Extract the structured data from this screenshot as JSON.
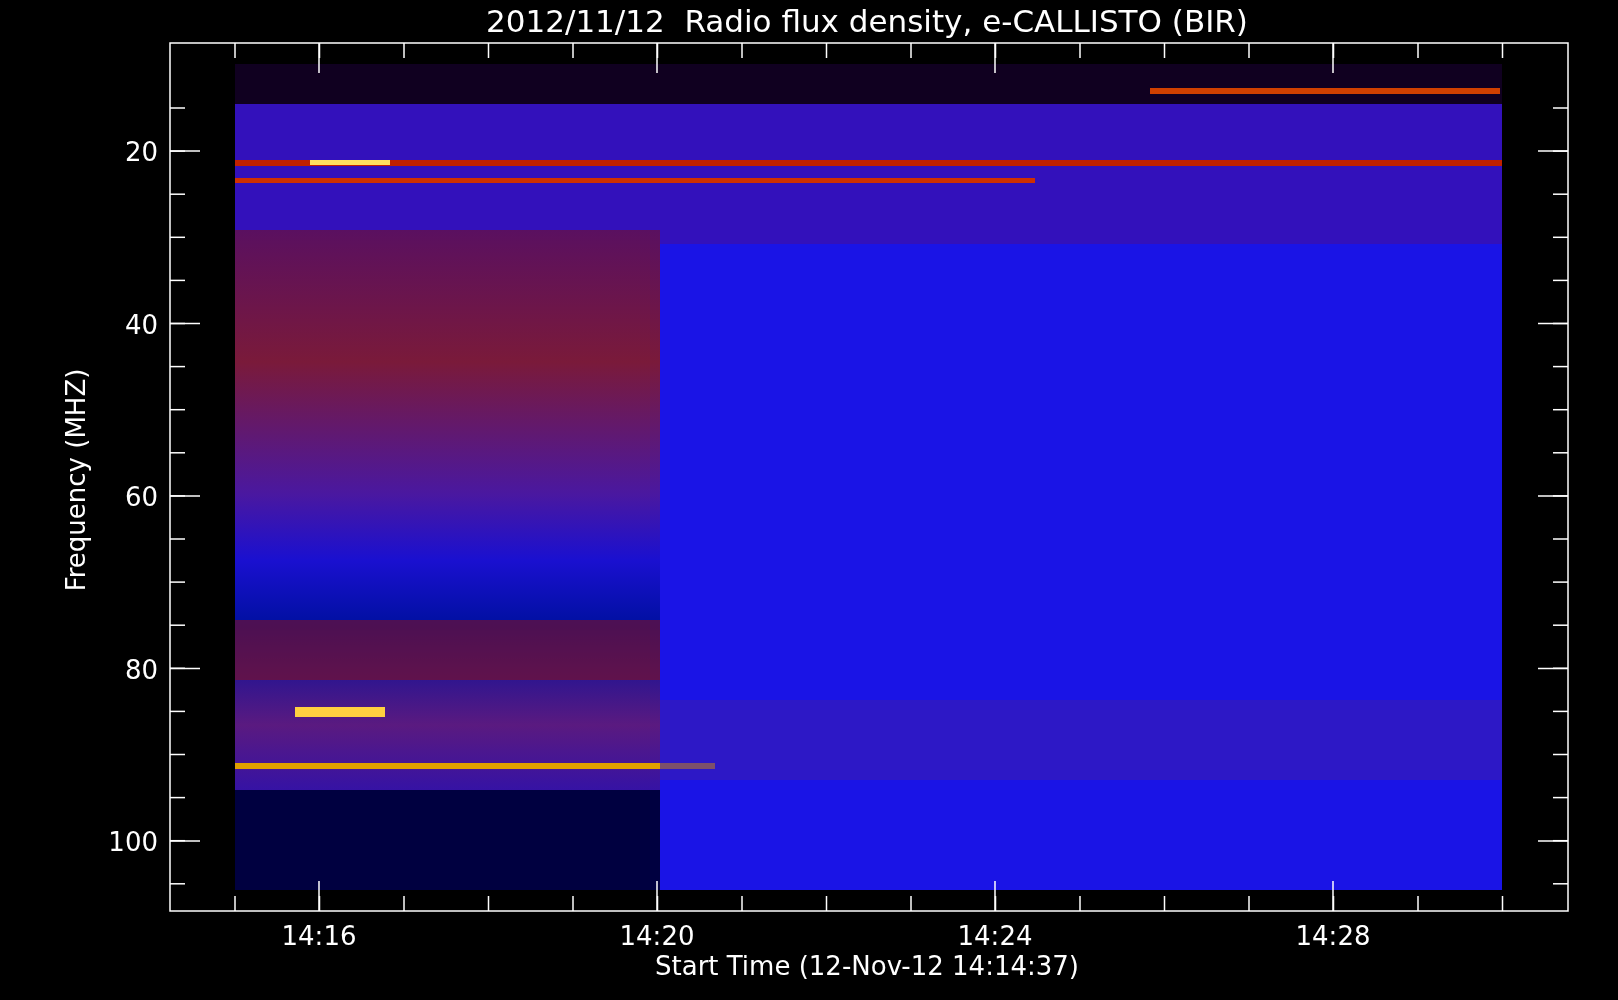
{
  "title": "2012/11/12  Radio flux density, e-CALLISTO (BIR)",
  "ylabel": "Frequency (MHZ)",
  "xlabel": "Start Time (12-Nov-12 14:14:37)",
  "yticks": [
    "20",
    "40",
    "60",
    "80",
    "100"
  ],
  "xticks": [
    "14:16",
    "14:20",
    "14:24",
    "14:28"
  ]
}
